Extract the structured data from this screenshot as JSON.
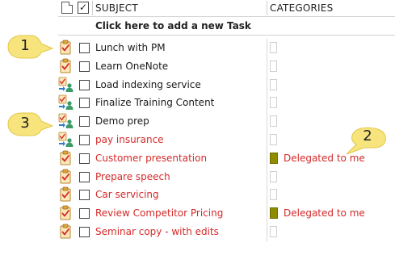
{
  "header": {
    "subject_label": "SUBJECT",
    "categories_label": "CATEGORIES",
    "complete_check_glyph": "✓"
  },
  "new_task": {
    "label": "Click here to add a new Task"
  },
  "colors": {
    "overdue_text": "#d42a2a",
    "normal_text": "#1a1a1a",
    "category_delegated": "#8f8c00",
    "callout_fill": "#f7e47c"
  },
  "tasks": [
    {
      "subject": "Lunch with PM",
      "icon": "task-clipboard-icon",
      "overdue": false,
      "category": ""
    },
    {
      "subject": "Learn OneNote",
      "icon": "task-clipboard-icon",
      "overdue": false,
      "category": ""
    },
    {
      "subject": "Load indexing service",
      "icon": "assigned-task-icon",
      "overdue": false,
      "category": ""
    },
    {
      "subject": "Finalize Training Content",
      "icon": "assigned-task-icon",
      "overdue": false,
      "category": ""
    },
    {
      "subject": "Demo prep",
      "icon": "assigned-task-icon",
      "overdue": false,
      "category": ""
    },
    {
      "subject": "pay insurance",
      "icon": "assigned-task-icon",
      "overdue": true,
      "category": ""
    },
    {
      "subject": "Customer presentation",
      "icon": "task-clipboard-icon",
      "overdue": true,
      "category": "Delegated to me"
    },
    {
      "subject": "Prepare speech",
      "icon": "task-clipboard-icon",
      "overdue": true,
      "category": ""
    },
    {
      "subject": "Car servicing",
      "icon": "task-clipboard-icon",
      "overdue": true,
      "category": ""
    },
    {
      "subject": "Review Competitor Pricing",
      "icon": "task-clipboard-icon",
      "overdue": true,
      "category": "Delegated to me"
    },
    {
      "subject": "Seminar copy - with edits",
      "icon": "task-clipboard-icon",
      "overdue": true,
      "category": ""
    }
  ],
  "callouts": [
    {
      "number": "1"
    },
    {
      "number": "2"
    },
    {
      "number": "3"
    }
  ]
}
